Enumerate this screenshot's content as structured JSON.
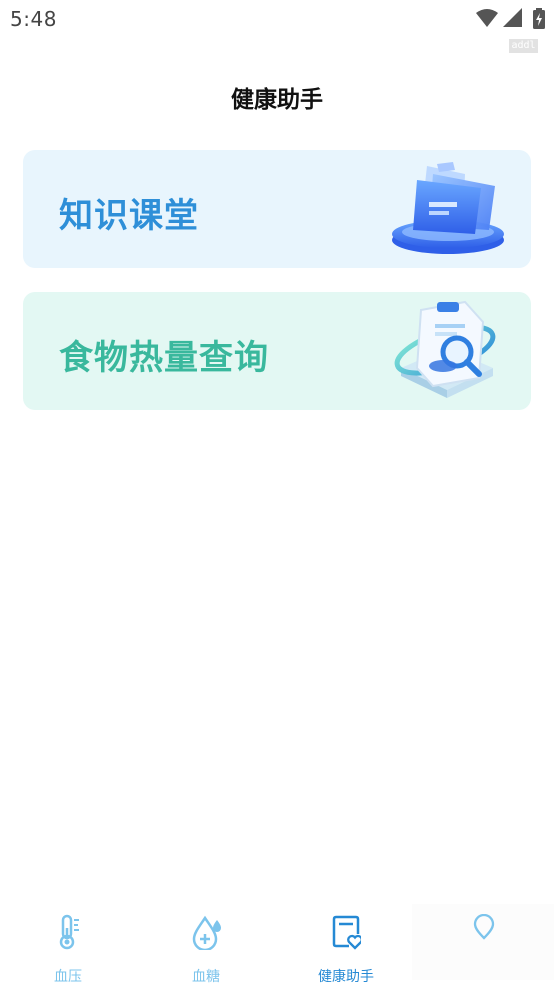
{
  "status_bar": {
    "time": "5:48",
    "icons": [
      "wifi-icon",
      "cellular-signal-icon",
      "battery-charging-icon"
    ],
    "debug_tag": "addl"
  },
  "header": {
    "title": "健康助手"
  },
  "cards": [
    {
      "label": "知识课堂",
      "icon": "folder-stack-illustration",
      "color": "#2e8fd8",
      "background": "#e8f5fd"
    },
    {
      "label": "食物热量查询",
      "icon": "clipboard-search-illustration",
      "color": "#39b89d",
      "background": "#e3f8f3"
    }
  ],
  "tab_bar": {
    "items": [
      {
        "label": "血压",
        "icon": "thermometer-icon",
        "active": false
      },
      {
        "label": "血糖",
        "icon": "drop-plus-icon",
        "active": false
      },
      {
        "label": "健康助手",
        "icon": "clipboard-heart-icon",
        "active": true
      },
      {
        "label": "",
        "icon": "location-pin-icon",
        "active": false
      }
    ],
    "active_color": "#2589d4",
    "inactive_color": "#7cc4ec"
  }
}
